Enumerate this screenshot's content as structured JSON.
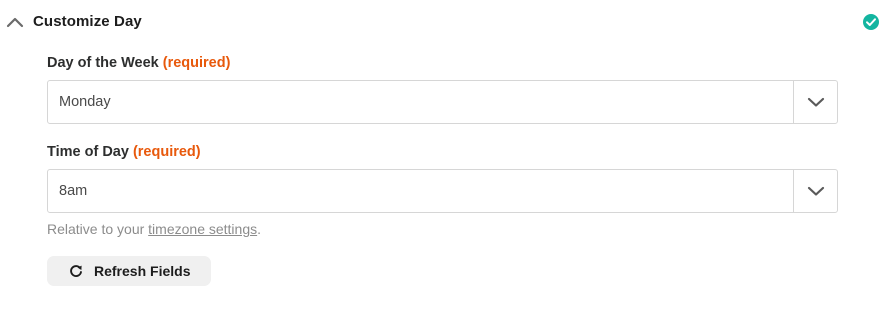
{
  "section": {
    "title": "Customize Day",
    "status_color": "#13b5a0"
  },
  "fields": [
    {
      "label": "Day of the Week",
      "required_text": "(required)",
      "value": "Monday"
    },
    {
      "label": "Time of Day",
      "required_text": "(required)",
      "value": "8am"
    }
  ],
  "help": {
    "prefix": "Relative to your ",
    "link": "timezone settings",
    "suffix": "."
  },
  "refresh_button": {
    "label": "Refresh Fields",
    "icon": "refresh-icon"
  },
  "colors": {
    "required": "#e8590c",
    "border": "#d6d6d6",
    "button_bg": "#f0f0f0"
  }
}
